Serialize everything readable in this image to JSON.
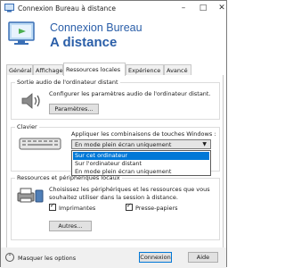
{
  "window": {
    "title": "Connexion Bureau à distance"
  },
  "header": {
    "line1": "Connexion Bureau",
    "line2": "A distance"
  },
  "tabs": [
    {
      "label": "Général"
    },
    {
      "label": "Affichage"
    },
    {
      "label": "Ressources locales"
    },
    {
      "label": "Expérience"
    },
    {
      "label": "Avancé"
    }
  ],
  "audio": {
    "title": "Sortie audio de l'ordinateur distant",
    "description": "Configurer les paramètres audio de l'ordinateur distant.",
    "button": "Paramètres..."
  },
  "keyboard": {
    "title": "Clavier",
    "description": "Appliquer les combinaisons de touches Windows :",
    "selected": "En mode plein écran uniquement",
    "options": [
      "Sur cet ordinateur",
      "Sur l'ordinateur distant",
      "En mode plein écran uniquement"
    ]
  },
  "resources": {
    "title": "Ressources et périphériques locaux",
    "description_line1": "Choisissez les périphériques et les ressources que vous",
    "description_line2": "souhaitez utiliser dans la session à distance.",
    "printers_label": "Imprimantes",
    "printers_checked": true,
    "clipboard_label": "Presse-papiers",
    "clipboard_checked": true,
    "button": "Autres..."
  },
  "footer": {
    "hide_options": "Masquer les options",
    "connect": "Connexion",
    "help": "Aide"
  }
}
